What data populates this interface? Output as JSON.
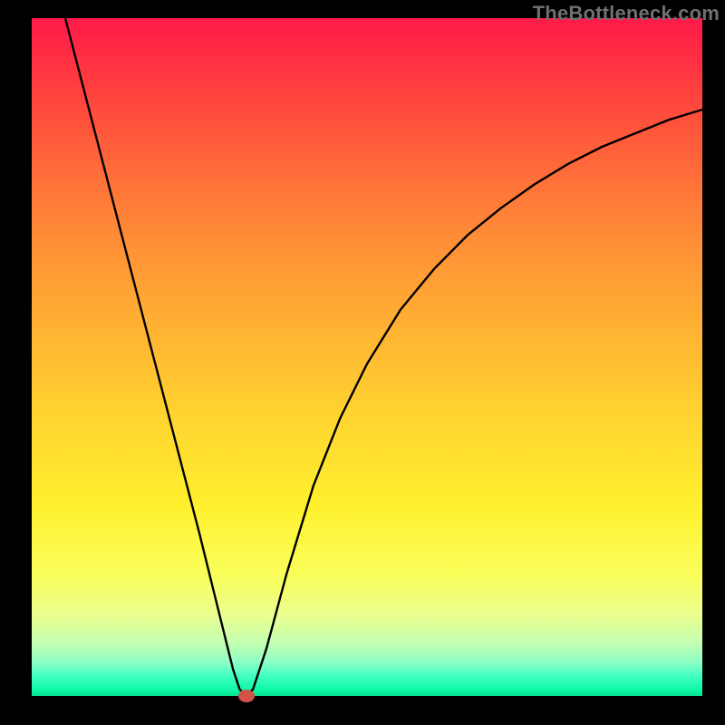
{
  "watermark": "TheBottleneck.com",
  "colors": {
    "background": "#000000",
    "curve": "#000000",
    "marker": "#d55248"
  },
  "chart_data": {
    "type": "line",
    "title": "",
    "xlabel": "",
    "ylabel": "",
    "xlim": [
      0,
      100
    ],
    "ylim": [
      0,
      100
    ],
    "grid": false,
    "legend": false,
    "series": [
      {
        "name": "bottleneck-curve",
        "x": [
          5,
          10,
          15,
          20,
          25,
          28,
          30,
          31,
          32,
          33,
          35,
          38,
          42,
          46,
          50,
          55,
          60,
          65,
          70,
          75,
          80,
          85,
          90,
          95,
          100
        ],
        "values": [
          100,
          81,
          62,
          43,
          24,
          12,
          4,
          1,
          0,
          1,
          7,
          18,
          31,
          41,
          49,
          57,
          63,
          68,
          72,
          75.5,
          78.5,
          81,
          83,
          85,
          86.5
        ]
      }
    ],
    "marker": {
      "x": 32,
      "y": 0
    }
  }
}
